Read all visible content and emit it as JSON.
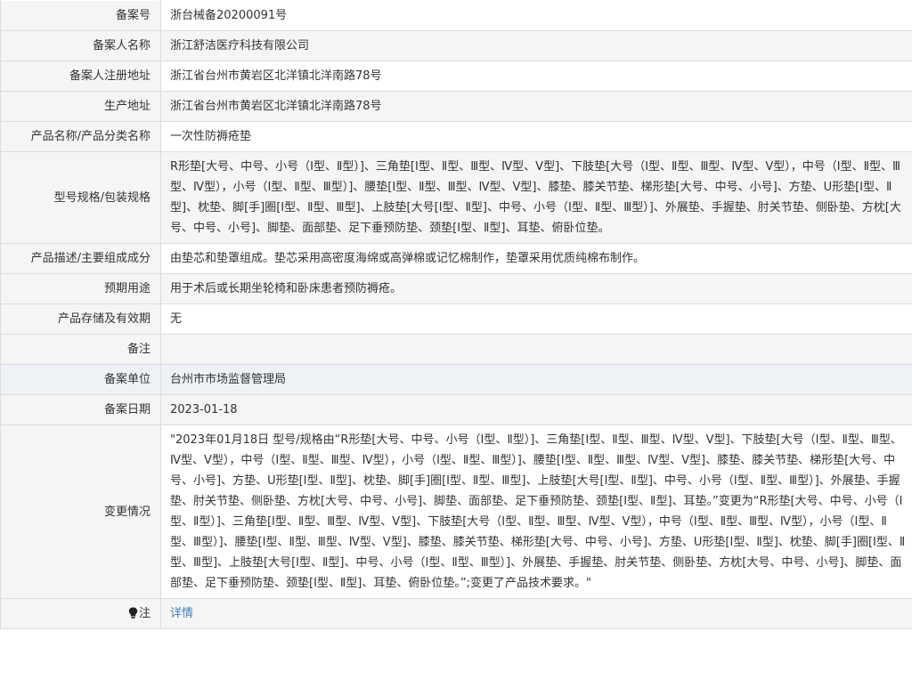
{
  "rows": {
    "record_no": {
      "label": "备案号",
      "value": "浙台械备20200091号"
    },
    "registrant_name": {
      "label": "备案人名称",
      "value": "浙江舒洁医疗科技有限公司"
    },
    "registrant_address": {
      "label": "备案人注册地址",
      "value": "浙江省台州市黄岩区北洋镇北洋南路78号"
    },
    "production_address": {
      "label": "生产地址",
      "value": "浙江省台州市黄岩区北洋镇北洋南路78号"
    },
    "product_name": {
      "label": "产品名称/产品分类名称",
      "value": "一次性防褥疮垫"
    },
    "model_spec": {
      "label": "型号规格/包装规格",
      "value": "R形垫[大号、中号、小号（Ⅰ型、Ⅱ型）]、三角垫[Ⅰ型、Ⅱ型、Ⅲ型、Ⅳ型、Ⅴ型]、下肢垫[大号（Ⅰ型、Ⅱ型、Ⅲ型、Ⅳ型、Ⅴ型），中号（Ⅰ型、Ⅱ型、Ⅲ型、Ⅳ型），小号（Ⅰ型、Ⅱ型、Ⅲ型）]、腰垫[Ⅰ型、Ⅱ型、Ⅲ型、Ⅳ型、Ⅴ型]、膝垫、膝关节垫、梯形垫[大号、中号、小号]、方垫、U形垫[Ⅰ型、Ⅱ型]、枕垫、脚[手]圈[Ⅰ型、Ⅱ型、Ⅲ型]、上肢垫[大号[Ⅰ型、Ⅱ型]、中号、小号（Ⅰ型、Ⅱ型、Ⅲ型）]、外展垫、手握垫、肘关节垫、侧卧垫、方枕[大号、中号、小号]、脚垫、面部垫、足下垂预防垫、颈垫[Ⅰ型、Ⅱ型]、耳垫、俯卧位垫。"
    },
    "description": {
      "label": "产品描述/主要组成成分",
      "value": "由垫芯和垫罩组成。垫芯采用高密度海绵或高弹棉或记忆棉制作，垫罩采用优质纯棉布制作。"
    },
    "intended_use": {
      "label": "预期用途",
      "value": "用于术后或长期坐轮椅和卧床患者预防褥疮。"
    },
    "storage": {
      "label": "产品存储及有效期",
      "value": "无"
    },
    "remarks": {
      "label": "备注",
      "value": ""
    },
    "record_unit": {
      "label": "备案单位",
      "value": "台州市市场监督管理局"
    },
    "record_date": {
      "label": "备案日期",
      "value": "2023-01-18"
    },
    "changes": {
      "label": "变更情况",
      "value": "\"2023年01月18日 型号/规格由“R形垫[大号、中号、小号（Ⅰ型、Ⅱ型）]、三角垫[Ⅰ型、Ⅱ型、Ⅲ型、Ⅳ型、Ⅴ型]、下肢垫[大号（Ⅰ型、Ⅱ型、Ⅲ型、Ⅳ型、Ⅴ型），中号（Ⅰ型、Ⅱ型、Ⅲ型、Ⅳ型），小号（Ⅰ型、Ⅱ型、Ⅲ型）]、腰垫[Ⅰ型、Ⅱ型、Ⅲ型、Ⅳ型、Ⅴ型]、膝垫、膝关节垫、梯形垫[大号、中号、小号]、方垫、U形垫[Ⅰ型、Ⅱ型]、枕垫、脚[手]圈[Ⅰ型、Ⅱ型、Ⅲ型]、上肢垫[大号[Ⅰ型、Ⅱ型]、中号、小号（Ⅰ型、Ⅱ型、Ⅲ型）]、外展垫、手握垫、肘关节垫、侧卧垫、方枕[大号、中号、小号]、脚垫、面部垫、足下垂预防垫、颈垫[Ⅰ型、Ⅱ型]、耳垫。”变更为“R形垫[大号、中号、小号（Ⅰ型、Ⅱ型）]、三角垫[Ⅰ型、Ⅱ型、Ⅲ型、Ⅳ型、Ⅴ型]、下肢垫[大号（Ⅰ型、Ⅱ型、Ⅲ型、Ⅳ型、Ⅴ型），中号（Ⅰ型、Ⅱ型、Ⅲ型、Ⅳ型），小号（Ⅰ型、Ⅱ型、Ⅲ型）]、腰垫[Ⅰ型、Ⅱ型、Ⅲ型、Ⅳ型、Ⅴ型]、膝垫、膝关节垫、梯形垫[大号、中号、小号]、方垫、U形垫[Ⅰ型、Ⅱ型]、枕垫、脚[手]圈[Ⅰ型、Ⅱ型、Ⅲ型]、上肢垫[大号[Ⅰ型、Ⅱ型]、中号、小号（Ⅰ型、Ⅱ型、Ⅲ型）]、外展垫、手握垫、肘关节垫、侧卧垫、方枕[大号、中号、小号]、脚垫、面部垫、足下垂预防垫、颈垫[Ⅰ型、Ⅱ型]、耳垫、俯卧位垫。”;变更了产品技术要求。\""
    },
    "note": {
      "label": "注",
      "link": "详情",
      "icon": "lightbulb-icon"
    }
  }
}
